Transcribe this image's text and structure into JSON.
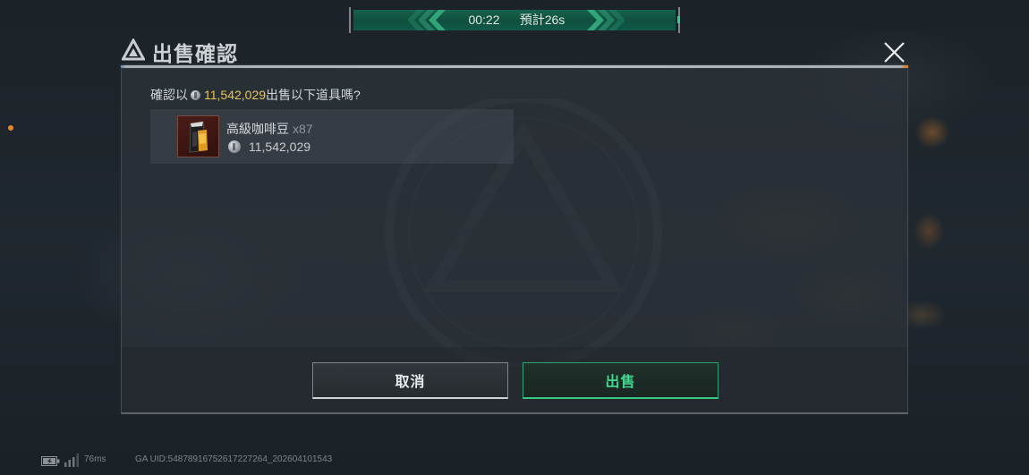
{
  "timer": {
    "elapsed": "00:22",
    "estimate": "預計26s"
  },
  "dialog": {
    "title": "出售確認",
    "prompt_prefix": "確認以",
    "prompt_amount": "11,542,029",
    "prompt_suffix": "出售以下道具嗎?",
    "item": {
      "name": "高級咖啡豆",
      "quantity": "x87",
      "price": "11,542,029"
    },
    "cancel_label": "取消",
    "sell_label": "出售"
  },
  "status_bar": {
    "ping": "76ms",
    "uid": "GA UID:54878916752617227264_202604101543"
  },
  "icons": {
    "logo": "game-logo-icon",
    "close": "close-icon",
    "currency": "coin-icon",
    "item": "coffee-beans-item-icon",
    "battery": "battery-icon",
    "signal": "signal-icon"
  },
  "colors": {
    "timer_green": "#0f4f3e",
    "amount_yellow": "#e9c45c",
    "sell_green": "#42d690",
    "notification_orange": "#e8872a",
    "item_rarity_red": "#4c1c17"
  }
}
